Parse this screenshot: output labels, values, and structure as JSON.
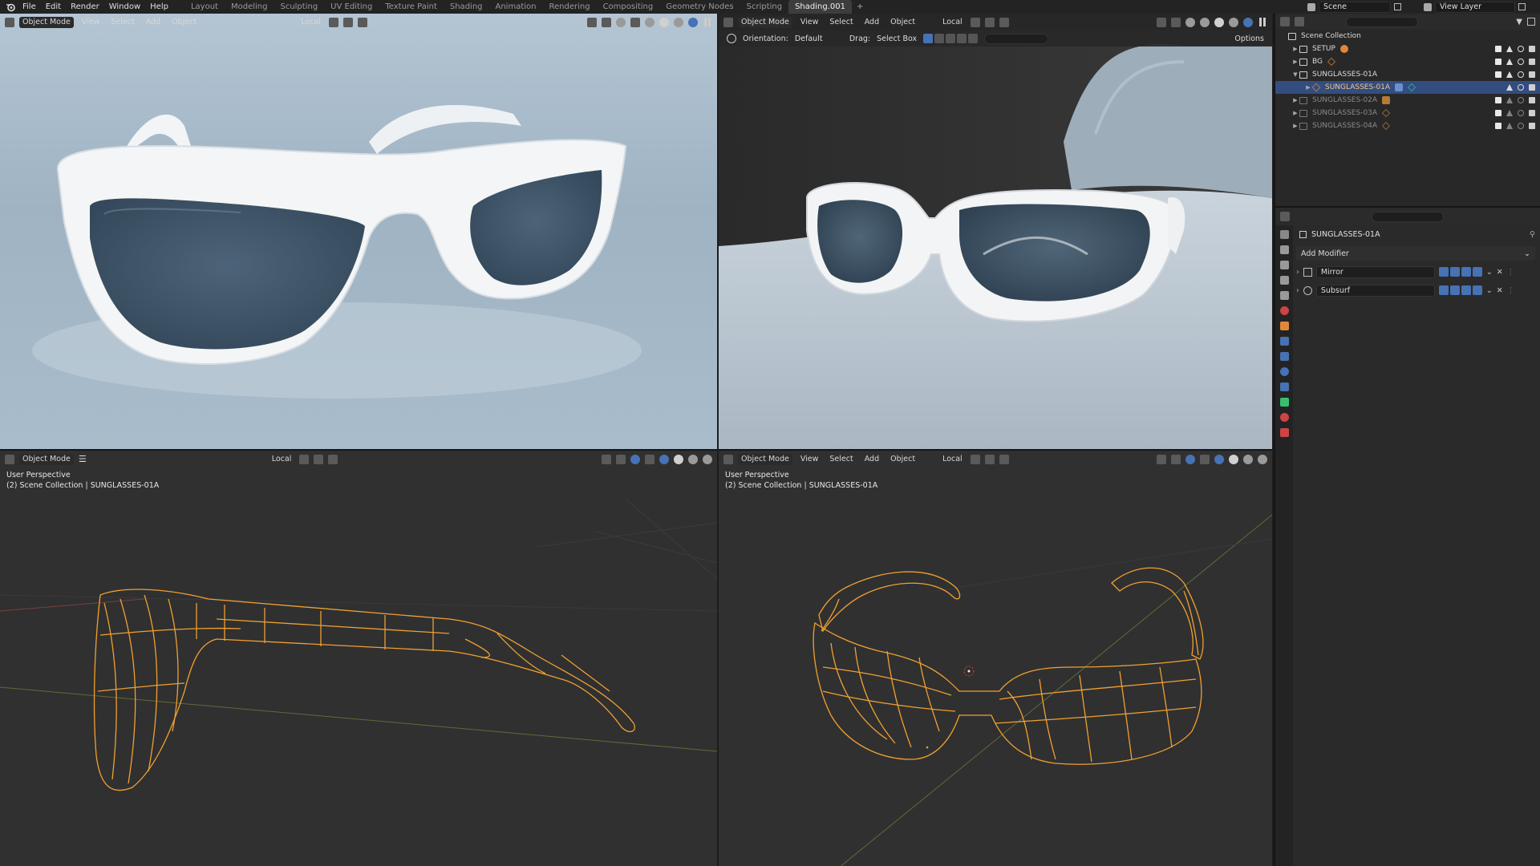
{
  "menu": [
    "File",
    "Edit",
    "Render",
    "Window",
    "Help"
  ],
  "workspaces": [
    "Layout",
    "Modeling",
    "Sculpting",
    "UV Editing",
    "Texture Paint",
    "Shading",
    "Animation",
    "Rendering",
    "Compositing",
    "Geometry Nodes",
    "Scripting",
    "Shading.001"
  ],
  "active_workspace": "Shading.001",
  "scene_name": "Scene",
  "view_layer": "View Layer",
  "viewport_header": {
    "mode": "Object Mode",
    "menus": [
      "View",
      "Select",
      "Add",
      "Object"
    ],
    "transform": "Local"
  },
  "viewport_tr_toolbar": {
    "orientation_label": "Orientation:",
    "orientation_value": "Default",
    "drag_label": "Drag:",
    "drag_value": "Select Box",
    "options": "Options"
  },
  "viewport_bottom": {
    "perspective": "User Perspective",
    "collection": "(2) Scene Collection | SUNGLASSES-01A"
  },
  "outliner": {
    "root": "Scene Collection",
    "rows": [
      {
        "name": "SETUP",
        "kind": "collection",
        "expanded": false,
        "dim": false,
        "selected": false
      },
      {
        "name": "BG",
        "kind": "collection",
        "expanded": false,
        "dim": false,
        "selected": false
      },
      {
        "name": "SUNGLASSES-01A",
        "kind": "collection",
        "expanded": true,
        "dim": false,
        "selected": false
      },
      {
        "name": "SUNGLASSES-01A",
        "kind": "object",
        "expanded": false,
        "dim": false,
        "selected": true
      },
      {
        "name": "SUNGLASSES-02A",
        "kind": "collection",
        "expanded": false,
        "dim": true,
        "selected": false
      },
      {
        "name": "SUNGLASSES-03A",
        "kind": "collection",
        "expanded": false,
        "dim": true,
        "selected": false
      },
      {
        "name": "SUNGLASSES-04A",
        "kind": "collection",
        "expanded": false,
        "dim": true,
        "selected": false
      }
    ]
  },
  "properties": {
    "object_name": "SUNGLASSES-01A",
    "add_modifier": "Add Modifier",
    "modifiers": [
      "Mirror",
      "Subsurf"
    ]
  },
  "colors": {
    "accent": "#4772b3",
    "selection": "#334d80",
    "wire": "#f0a030",
    "viewport_bg": "#303030"
  }
}
